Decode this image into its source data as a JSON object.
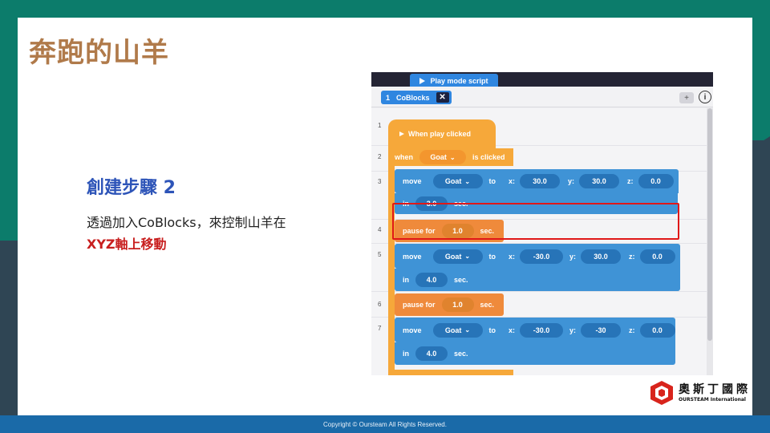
{
  "slide": {
    "title": "奔跑的山羊",
    "step_heading": "創建步驟 2",
    "desc_line1": "透過加入CoBlocks，來控制山羊在",
    "desc_line2": "XYZ軸上移動",
    "footer": "Copyright © Oursteam All Rights Reserved.",
    "logo_cn": "奧斯丁國際",
    "logo_en": "OURSTEAM International"
  },
  "screenshot": {
    "top_tab_label": "Play mode script",
    "tab_number": "1",
    "tab_label": "CoBlocks",
    "tab_close": "✕",
    "add_label": "+",
    "info_label": "i",
    "line_numbers": [
      "1",
      "2",
      "3",
      "4",
      "5",
      "6",
      "7"
    ],
    "hat_label": "When play clicked",
    "when_label": "when",
    "object_name": "Goat",
    "is_clicked_label": "is clicked",
    "move_label": "move",
    "to_label": "to",
    "x_label": "x:",
    "y_label": "y:",
    "z_label": "z:",
    "in_label": "in",
    "sec_label": "sec.",
    "pause_label": "pause for",
    "move1": {
      "x": "30.0",
      "y": "30.0",
      "z": "0.0",
      "time": "3.0"
    },
    "pause1": "1.0",
    "move2": {
      "x": "-30.0",
      "y": "30.0",
      "z": "0.0",
      "time": "4.0"
    },
    "pause2": "1.0",
    "move3": {
      "x": "-30.0",
      "y": "-30",
      "z": "0.0",
      "time": "4.0"
    }
  },
  "colors": {
    "title": "#b07a4a",
    "heading": "#2d54b8",
    "highlight_text": "#c81e1e",
    "teal": "#0c7c6b",
    "footer": "#1a6aa8",
    "block_orange": "#f6a83a",
    "block_blue": "#3f93d6",
    "highlight_box": "#e01818"
  }
}
